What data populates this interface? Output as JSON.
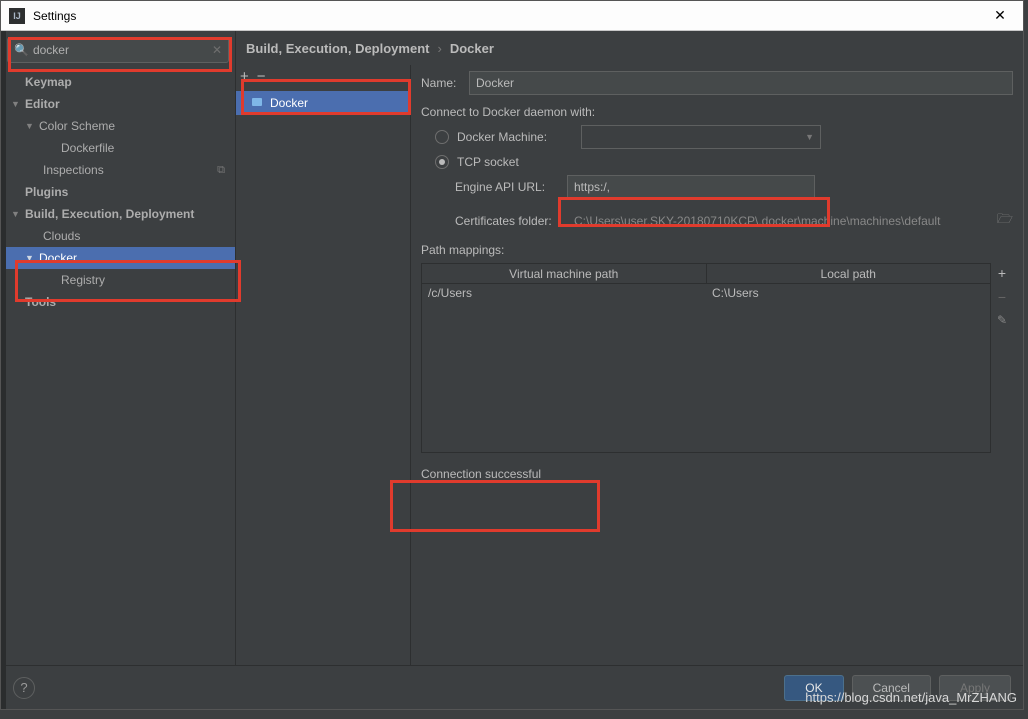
{
  "window": {
    "title": "Settings"
  },
  "search": {
    "value": "docker"
  },
  "tree": {
    "keymap": "Keymap",
    "editor": "Editor",
    "color_scheme": "Color Scheme",
    "dockerfile": "Dockerfile",
    "inspections": "Inspections",
    "plugins": "Plugins",
    "bed": "Build, Execution, Deployment",
    "clouds": "Clouds",
    "docker": "Docker",
    "registry": "Registry",
    "tools": "Tools"
  },
  "breadcrumb": {
    "a": "Build, Execution, Deployment",
    "b": "Docker"
  },
  "list": {
    "docker": "Docker"
  },
  "form": {
    "name_label": "Name:",
    "name_value": "Docker",
    "connect_title": "Connect to Docker daemon with:",
    "docker_machine": "Docker Machine:",
    "tcp_socket": "TCP socket",
    "engine_url_label": "Engine API URL:",
    "engine_url_value": "https:/,",
    "cert_label": "Certificates folder:",
    "cert_value": "C:\\Users\\user.SKY-20180710KCP\\.docker\\machine\\machines\\default",
    "path_mappings": "Path mappings:",
    "col_vm": "Virtual machine path",
    "col_local": "Local path",
    "row_vm": "/c/Users",
    "row_local": "C:\\Users",
    "status": "Connection successful"
  },
  "buttons": {
    "ok": "OK",
    "cancel": "Cancel",
    "apply": "Apply"
  },
  "watermark": "https://blog.csdn.net/java_MrZHANG"
}
